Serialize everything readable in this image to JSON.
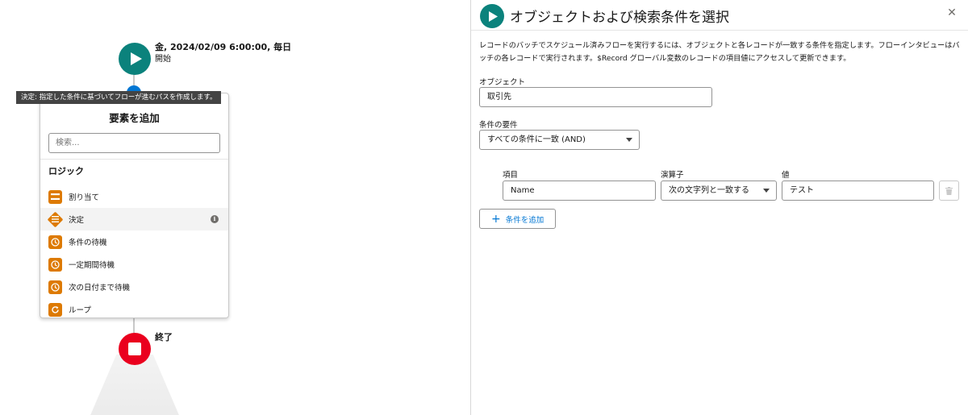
{
  "canvas": {
    "start": {
      "title": "金, 2024/02/09 6:00:00, 毎日",
      "label": "開始"
    },
    "tooltip": "決定: 指定した条件に基づいてフローが進むパスを作成します。",
    "menu": {
      "title": "要素を追加",
      "search_placeholder": "検索...",
      "heading": "ロジック",
      "items": [
        {
          "label": "割り当て",
          "icon": "assignment-icon"
        },
        {
          "label": "決定",
          "icon": "decision-icon"
        },
        {
          "label": "条件の待機",
          "icon": "clock-icon"
        },
        {
          "label": "一定期間待機",
          "icon": "clock-icon"
        },
        {
          "label": "次の日付まで待機",
          "icon": "clock-icon"
        },
        {
          "label": "ループ",
          "icon": "loop-icon"
        }
      ]
    },
    "end": {
      "label": "終了"
    }
  },
  "panel": {
    "title": "オブジェクトおよび検索条件を選択",
    "description_line1": "レコードのバッチでスケジュール済みフローを実行するには、オブジェクトと各レコードが一致する条件を指定します。フローインタビューはバ",
    "description_line2": "ッチの各レコードで実行されます。$Record グローバル変数のレコードの項目値にアクセスして更新できます。",
    "object_label": "オブジェクト",
    "object_value": "取引先",
    "condition_req_label": "条件の要件",
    "condition_req_value": "すべての条件に一致 (AND)",
    "col_field": "項目",
    "col_operator": "演算子",
    "col_value": "値",
    "row": {
      "field": "Name",
      "operator": "次の文字列と一致する",
      "value": "テスト"
    },
    "add_condition": "条件を追加"
  },
  "colors": {
    "teal": "#0b827c",
    "orange": "#dd7a01",
    "red": "#ea001e",
    "brand_blue": "#0176d3"
  }
}
